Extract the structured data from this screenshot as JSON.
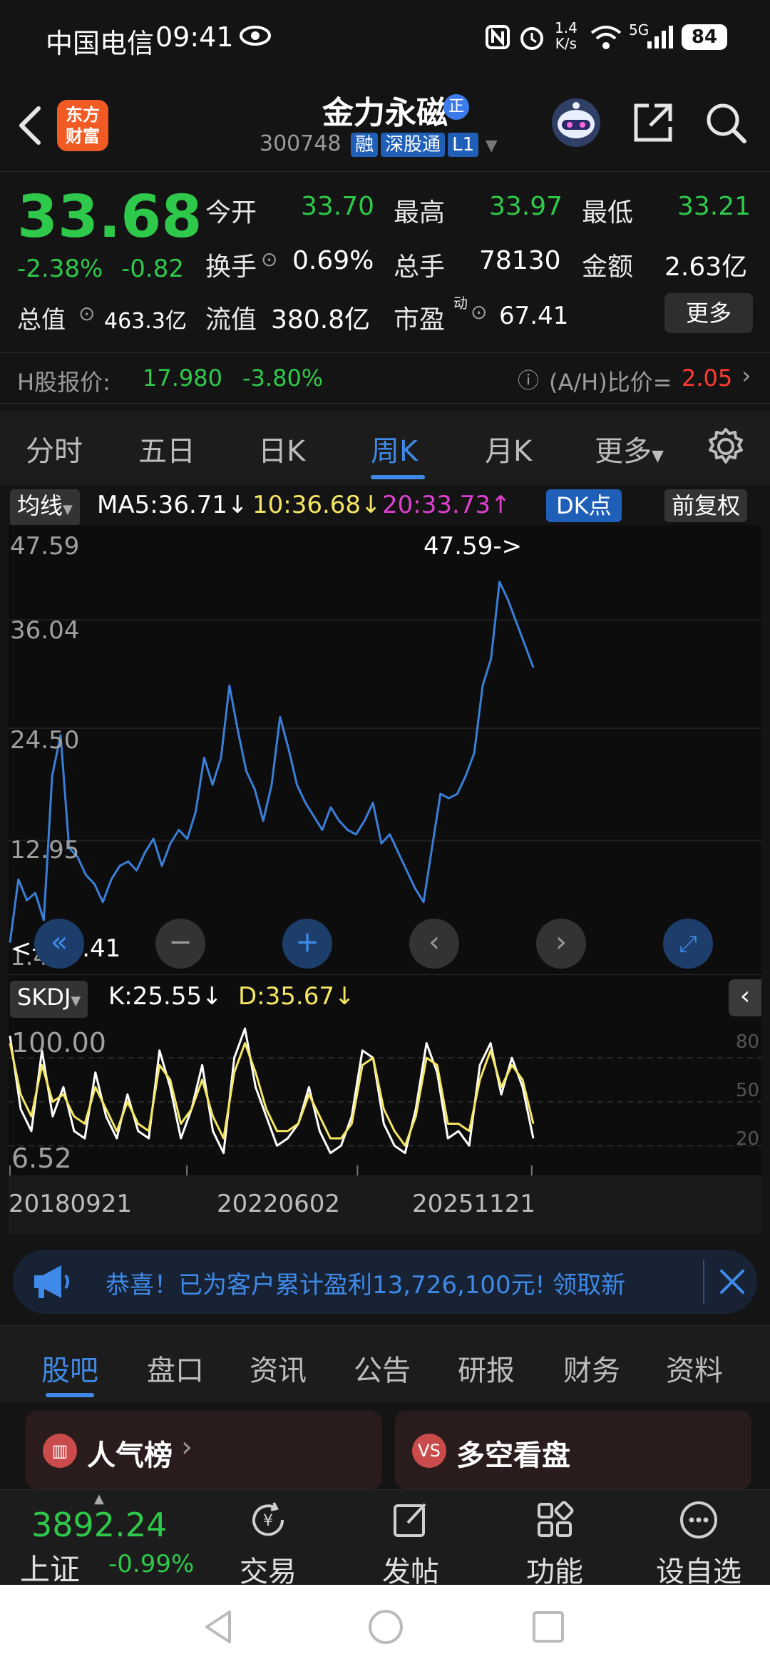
{
  "status": {
    "carrier": "中国电信",
    "time": "09:41",
    "speed_top": "1.4",
    "speed_unit": "K/s",
    "network": "5G",
    "battery": "84"
  },
  "header": {
    "logo": "东方\n财富",
    "stock_name": "金力永磁",
    "stock_code": "300748",
    "tags": [
      "融",
      "深股通",
      "L1"
    ],
    "verify_badge": "正"
  },
  "quote": {
    "price": "33.68",
    "change_pct": "-2.38%",
    "change_amt": "-0.82",
    "open_label": "今开",
    "open": "33.70",
    "high_label": "最高",
    "high": "33.97",
    "low_label": "最低",
    "low": "33.21",
    "turnover_label": "换手",
    "turnover": "0.69%",
    "volume_label": "总手",
    "volume": "78130",
    "amount_label": "金额",
    "amount": "2.63亿",
    "total_mv_label": "总值",
    "total_mv": "463.3亿",
    "float_mv_label": "流值",
    "float_mv": "380.8亿",
    "pe_label": "市盈",
    "pe_sup": "动",
    "pe": "67.41",
    "more": "更多"
  },
  "h_share": {
    "label": "H股报价:",
    "price": "17.980",
    "change": "-3.80%",
    "ratio_label": "(A/H)比价=",
    "ratio": "2.05"
  },
  "tabs": {
    "items": [
      "分时",
      "五日",
      "日K",
      "周K",
      "月K",
      "更多"
    ],
    "active": "周K"
  },
  "ma": {
    "toggle": "均线",
    "ma5": "MA5:36.71↓",
    "ma10": "10:36.68↓",
    "ma20": "20:33.73↑",
    "dk": "DK点",
    "adjust": "前复权"
  },
  "main_chart": {
    "y_labels": [
      "47.59",
      "36.04",
      "24.50",
      "12.95",
      "1.41"
    ],
    "max_marker": "47.59->",
    "min_marker": "<----1.41"
  },
  "indicator": {
    "name": "SKDJ",
    "k": "K:25.55↓",
    "d": "D:35.67↓",
    "y_labels": [
      "100.00",
      "6.52"
    ],
    "right_labels": [
      "80",
      "50",
      "20"
    ]
  },
  "x_labels": [
    "20180921",
    "20220602",
    "20251121"
  ],
  "colors": {
    "price_line": "#3a7fd8",
    "k_line": "#ffffff",
    "d_line": "#f5e663",
    "up": "#ff3b30",
    "down": "#2ec94b",
    "accent": "#3f8ae8"
  },
  "chart_data": [
    {
      "type": "line",
      "title": "",
      "ylim": [
        1.41,
        47.59
      ],
      "series": [
        {
          "values": [
            3.5,
            10.5,
            8.2,
            9.0,
            6.0,
            22.0,
            26.5,
            14.0,
            13.0,
            11.0,
            10.0,
            8.0,
            10.5,
            12.0,
            12.5,
            11.5,
            13.5,
            15.0,
            12.0,
            14.5,
            16.0,
            15.0,
            18.0,
            24.0,
            21.0,
            24.0,
            32.0,
            27.0,
            22.5,
            20.5,
            17.0,
            21.0,
            28.5,
            25.0,
            21.0,
            19.0,
            17.5,
            16.0,
            18.5,
            17.0,
            16.0,
            15.5,
            17.0,
            19.0,
            14.5,
            15.5,
            13.5,
            11.5,
            9.5,
            8.0,
            14.0,
            20.0,
            19.5,
            20.0,
            22.0,
            24.5,
            32.0,
            35.0,
            43.5,
            41.5,
            39.0,
            36.5,
            34.0
          ]
        }
      ]
    },
    {
      "type": "line",
      "title": "SKDJ",
      "ylim": [
        6.52,
        100.0
      ],
      "series": [
        {
          "name": "K",
          "values": [
            95,
            45,
            30,
            85,
            40,
            60,
            30,
            25,
            70,
            40,
            25,
            55,
            30,
            25,
            85,
            60,
            25,
            45,
            75,
            30,
            15,
            80,
            100,
            60,
            40,
            20,
            25,
            35,
            60,
            30,
            15,
            20,
            40,
            85,
            80,
            35,
            20,
            15,
            45,
            90,
            70,
            25,
            30,
            20,
            75,
            90,
            55,
            80,
            60,
            25
          ]
        },
        {
          "name": "D",
          "values": [
            90,
            55,
            40,
            75,
            50,
            55,
            40,
            35,
            60,
            45,
            30,
            50,
            35,
            30,
            75,
            65,
            35,
            45,
            65,
            40,
            25,
            70,
            90,
            70,
            45,
            30,
            30,
            35,
            55,
            40,
            25,
            25,
            35,
            75,
            80,
            45,
            30,
            20,
            40,
            80,
            75,
            35,
            35,
            30,
            65,
            85,
            60,
            75,
            65,
            35
          ]
        }
      ]
    }
  ],
  "banner": {
    "text": "恭喜！已为客户累计盈利13,726,100元! 领取新"
  },
  "subtabs": {
    "items": [
      "股吧",
      "盘口",
      "资讯",
      "公告",
      "研报",
      "财务",
      "资料"
    ],
    "active": "股吧"
  },
  "cards": [
    {
      "label": "人气榜",
      "icon": "bar-chart-icon"
    },
    {
      "label": "多空看盘",
      "icon": "vs-icon"
    }
  ],
  "bottom_nav": {
    "index_value": "3892.24",
    "index_name": "上证",
    "index_change": "-0.99%",
    "items": [
      "交易",
      "发帖",
      "功能",
      "设自选"
    ]
  }
}
